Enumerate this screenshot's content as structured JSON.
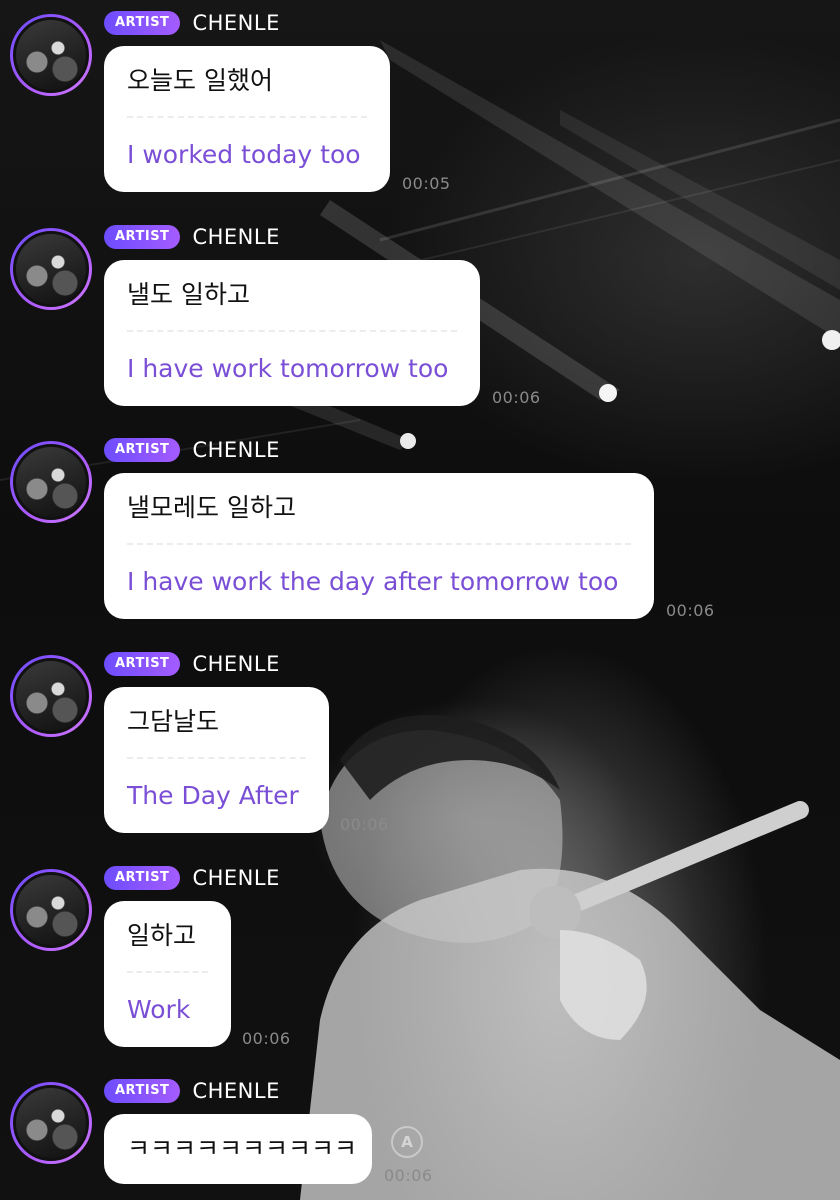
{
  "colors": {
    "badge_gradient_start": "#6d4dff",
    "badge_gradient_end": "#a45cff",
    "translation_text": "#7a4fd6",
    "timestamp": "#8a8a8a"
  },
  "messages": [
    {
      "badge": "ARTIST",
      "sender": "CHENLE",
      "korean": "오늘도 일했어",
      "translation": "I worked today too",
      "time": "00:05"
    },
    {
      "badge": "ARTIST",
      "sender": "CHENLE",
      "korean": "낼도 일하고",
      "translation": "I have work tomorrow too",
      "time": "00:06"
    },
    {
      "badge": "ARTIST",
      "sender": "CHENLE",
      "korean": "낼모레도 일하고",
      "translation": "I have work the day after tomorrow too",
      "time": "00:06"
    },
    {
      "badge": "ARTIST",
      "sender": "CHENLE",
      "korean": "그담날도",
      "translation": "The Day After",
      "time": "00:06"
    },
    {
      "badge": "ARTIST",
      "sender": "CHENLE",
      "korean": "일하고",
      "translation": "Work",
      "time": "00:06"
    },
    {
      "badge": "ARTIST",
      "sender": "CHENLE",
      "korean": "ㅋㅋㅋㅋㅋㅋㅋㅋㅋㅋ",
      "time": "00:06",
      "translate_icon": "translate-icon"
    }
  ]
}
